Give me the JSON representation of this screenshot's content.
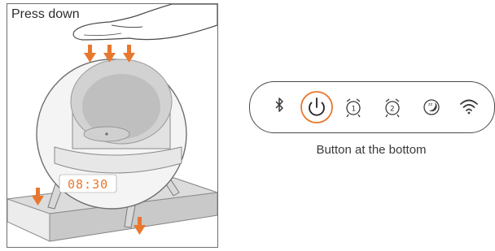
{
  "illustration": {
    "label": "Press down",
    "clock_time": "08:30",
    "accent_color": "#e8782e"
  },
  "buttons_panel": {
    "caption": "Button at the bottom",
    "icons": [
      "bluetooth-icon",
      "power-icon",
      "alarm-1-icon",
      "alarm-2-icon",
      "sleep-icon",
      "wifi-icon"
    ],
    "highlight_color": "#e8782e"
  }
}
